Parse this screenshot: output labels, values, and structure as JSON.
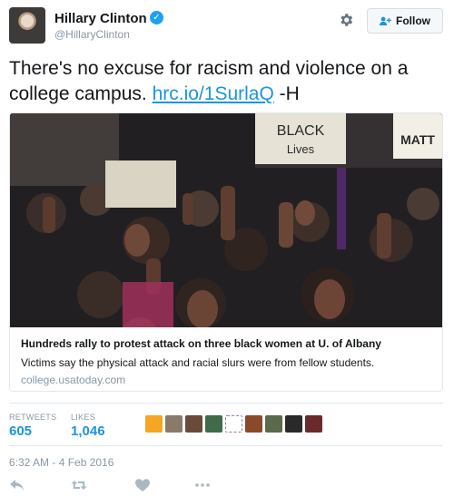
{
  "author": {
    "name": "Hillary Clinton",
    "handle": "@HillaryClinton",
    "verified": true,
    "follow_label": "Follow"
  },
  "tweet": {
    "text": "There's no excuse for racism and violence on a college campus.",
    "link": "hrc.io/1SurlaQ",
    "signature": "-H"
  },
  "card": {
    "photo_signs": [
      "BLACK",
      "Lives",
      "MATT"
    ],
    "title": "Hundreds rally to protest attack on three black women at U. of Albany",
    "description": "Victims say the physical attack and racial slurs were from fellow students.",
    "domain": "college.usatoday.com"
  },
  "stats": {
    "retweets_label": "RETWEETS",
    "retweets_value": "605",
    "likes_label": "LIKES",
    "likes_value": "1,046"
  },
  "timestamp": "6:32 AM - 4 Feb 2016",
  "icons": {
    "verified": "verified-badge-icon",
    "settings": "gear-icon",
    "follow": "add-user-icon",
    "reply": "reply-icon",
    "retweet": "retweet-icon",
    "like": "heart-icon",
    "more": "more-icon"
  },
  "colors": {
    "link": "#1b95e0",
    "verified": "#1da1f2",
    "muted": "#8899a6",
    "border": "#e1e8ed"
  }
}
